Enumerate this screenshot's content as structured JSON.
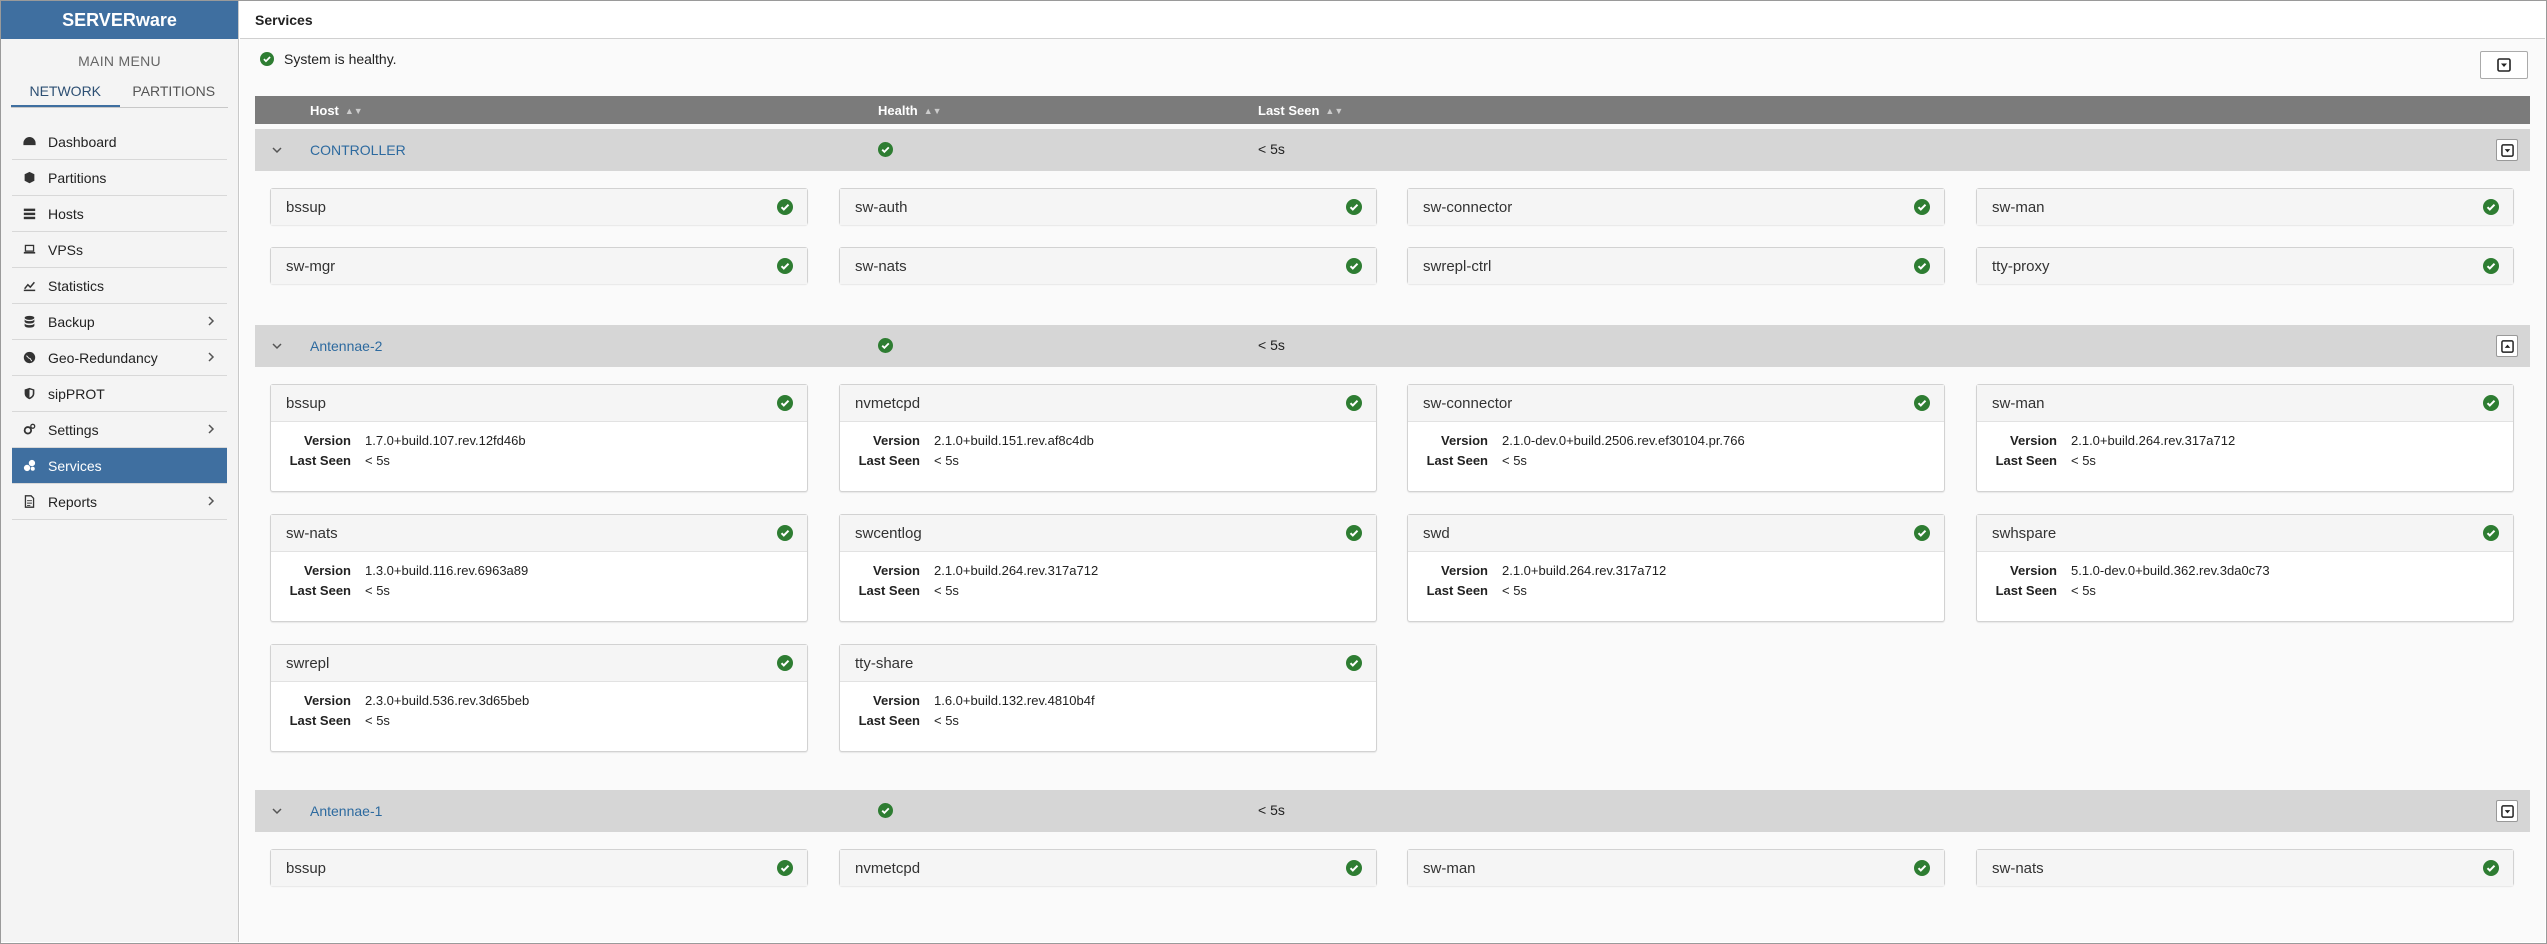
{
  "app": {
    "brand": "SERVERware"
  },
  "sidebar": {
    "menu_title": "MAIN MENU",
    "tabs": [
      {
        "label": "NETWORK"
      },
      {
        "label": "PARTITIONS"
      }
    ],
    "items": [
      {
        "label": "Dashboard",
        "icon": "dashboard-icon"
      },
      {
        "label": "Partitions",
        "icon": "partitions-icon"
      },
      {
        "label": "Hosts",
        "icon": "hosts-icon"
      },
      {
        "label": "VPSs",
        "icon": "laptop-icon"
      },
      {
        "label": "Statistics",
        "icon": "chart-icon"
      },
      {
        "label": "Backup",
        "icon": "database-icon"
      },
      {
        "label": "Geo-Redundancy",
        "icon": "globe-icon"
      },
      {
        "label": "sipPROT",
        "icon": "shield-icon"
      },
      {
        "label": "Settings",
        "icon": "gears-icon"
      },
      {
        "label": "Services",
        "icon": "services-icon"
      },
      {
        "label": "Reports",
        "icon": "report-icon"
      }
    ]
  },
  "page": {
    "title": "Services",
    "status_text": "System is healthy."
  },
  "table": {
    "columns": [
      {
        "label": "Host"
      },
      {
        "label": "Health"
      },
      {
        "label": "Last Seen"
      }
    ]
  },
  "labels": {
    "version": "Version",
    "last_seen": "Last Seen"
  },
  "groups": [
    {
      "name": "CONTROLLER",
      "last_seen": "< 5s",
      "services": [
        {
          "name": "bssup"
        },
        {
          "name": "sw-auth"
        },
        {
          "name": "sw-connector"
        },
        {
          "name": "sw-man"
        },
        {
          "name": "sw-mgr"
        },
        {
          "name": "sw-nats"
        },
        {
          "name": "swrepl-ctrl"
        },
        {
          "name": "tty-proxy"
        }
      ]
    },
    {
      "name": "Antennae-2",
      "last_seen": "< 5s",
      "services": [
        {
          "name": "bssup",
          "version": "1.7.0+build.107.rev.12fd46b",
          "last_seen": "< 5s"
        },
        {
          "name": "nvmetcpd",
          "version": "2.1.0+build.151.rev.af8c4db",
          "last_seen": "< 5s"
        },
        {
          "name": "sw-connector",
          "version": "2.1.0-dev.0+build.2506.rev.ef30104.pr.766",
          "last_seen": "< 5s"
        },
        {
          "name": "sw-man",
          "version": "2.1.0+build.264.rev.317a712",
          "last_seen": "< 5s"
        },
        {
          "name": "sw-nats",
          "version": "1.3.0+build.116.rev.6963a89",
          "last_seen": "< 5s"
        },
        {
          "name": "swcentlog",
          "version": "2.1.0+build.264.rev.317a712",
          "last_seen": "< 5s"
        },
        {
          "name": "swd",
          "version": "2.1.0+build.264.rev.317a712",
          "last_seen": "< 5s"
        },
        {
          "name": "swhspare",
          "version": "5.1.0-dev.0+build.362.rev.3da0c73",
          "last_seen": "< 5s"
        },
        {
          "name": "swrepl",
          "version": "2.3.0+build.536.rev.3d65beb",
          "last_seen": "< 5s"
        },
        {
          "name": "tty-share",
          "version": "1.6.0+build.132.rev.4810b4f",
          "last_seen": "< 5s"
        }
      ]
    },
    {
      "name": "Antennae-1",
      "last_seen": "< 5s",
      "services": [
        {
          "name": "bssup"
        },
        {
          "name": "nvmetcpd"
        },
        {
          "name": "sw-man"
        },
        {
          "name": "sw-nats"
        }
      ]
    }
  ],
  "colors": {
    "accent": "#3f6fa0",
    "ok_green": "#2e7d32",
    "link": "#2d6a9f"
  }
}
